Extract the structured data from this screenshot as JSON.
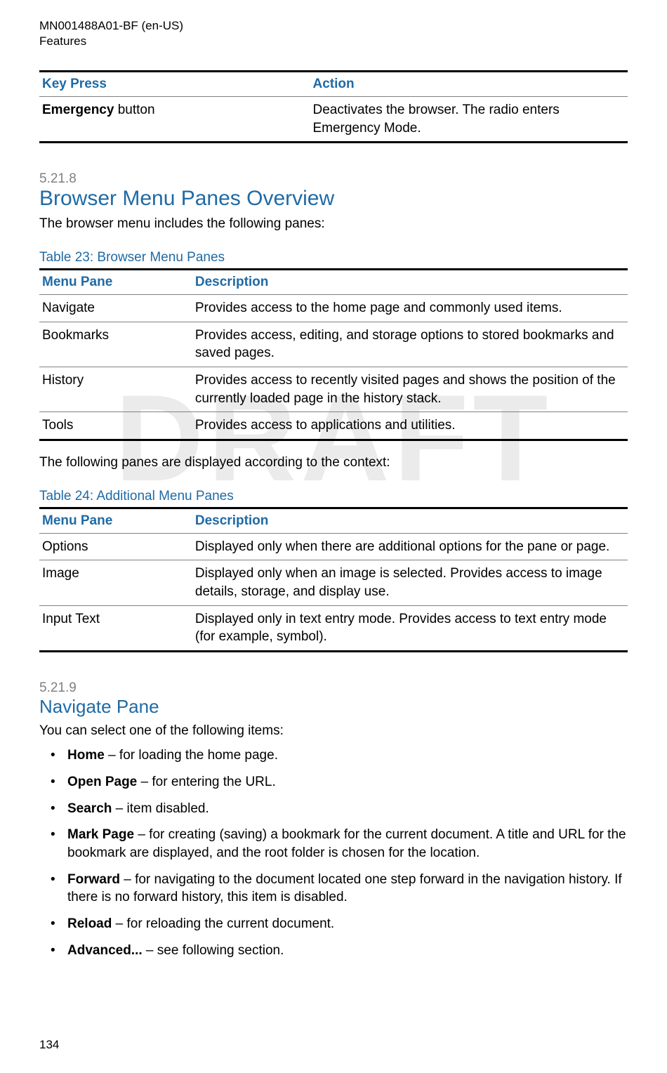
{
  "header": {
    "doc_id": "MN001488A01-BF (en-US)",
    "section_label": "Features"
  },
  "watermark": "DRAFT",
  "table_keypress": {
    "headers": [
      "Key Press",
      "Action"
    ],
    "rows": [
      {
        "key_bold": "Emergency",
        "key_rest": " button",
        "action": "Deactivates the browser. The radio enters Emergency Mode."
      }
    ]
  },
  "section_5_21_8": {
    "num": "5.21.8",
    "title": "Browser Menu Panes Overview",
    "intro": "The browser menu includes the following panes:"
  },
  "table23": {
    "caption": "Table 23: Browser Menu Panes",
    "headers": [
      "Menu Pane",
      "Description"
    ],
    "rows": [
      {
        "pane": "Navigate",
        "desc": "Provides access to the home page and commonly used items."
      },
      {
        "pane": "Bookmarks",
        "desc": "Provides access, editing, and storage options to stored bookmarks and saved pages."
      },
      {
        "pane": "History",
        "desc": "Provides access to recently visited pages and shows the position of the currently loaded page in the history stack."
      },
      {
        "pane": "Tools",
        "desc": "Provides access to applications and utilities."
      }
    ]
  },
  "between_tables": "The following panes are displayed according to the context:",
  "table24": {
    "caption": "Table 24: Additional Menu Panes",
    "headers": [
      "Menu Pane",
      "Description"
    ],
    "rows": [
      {
        "pane": "Options",
        "desc": "Displayed only when there are additional options for the pane or page."
      },
      {
        "pane": "Image",
        "desc": "Displayed only when an image is selected. Provides access to image details, storage, and display use."
      },
      {
        "pane": "Input Text",
        "desc": "Displayed only in text entry mode. Provides access to text entry mode (for example, symbol)."
      }
    ]
  },
  "section_5_21_9": {
    "num": "5.21.9",
    "title": "Navigate Pane",
    "intro": "You can select one of the following items:",
    "items": [
      {
        "label": "Home",
        "rest": " – for loading the home page."
      },
      {
        "label": "Open Page",
        "rest": " – for entering the URL."
      },
      {
        "label": "Search",
        "rest": " – item disabled."
      },
      {
        "label": "Mark Page",
        "rest": " – for creating (saving) a bookmark for the current document. A title and URL for the bookmark are displayed, and the root folder is chosen for the location."
      },
      {
        "label": "Forward",
        "rest": " – for navigating to the document located one step forward in the navigation history. If there is no forward history, this item is disabled."
      },
      {
        "label": "Reload",
        "rest": " – for reloading the current document."
      },
      {
        "label": "Advanced...",
        "rest": " – see following section."
      }
    ]
  },
  "page_number": "134"
}
